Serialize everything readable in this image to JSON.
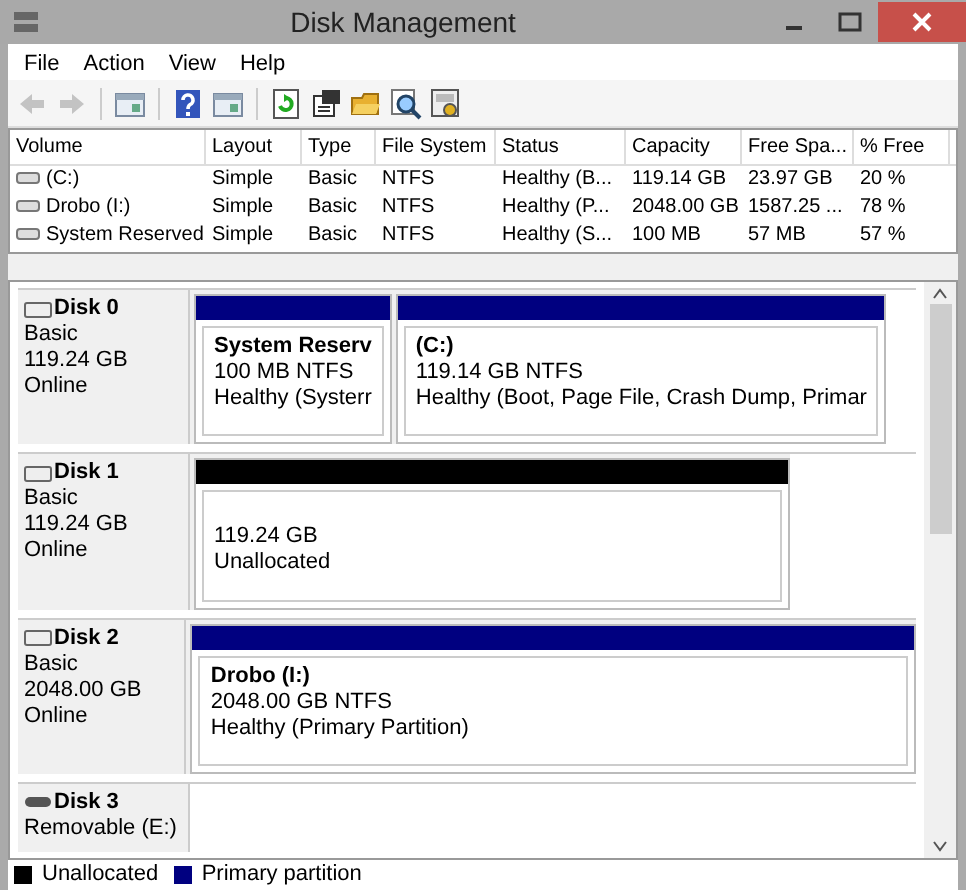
{
  "window": {
    "title": "Disk Management"
  },
  "menu": [
    "File",
    "Action",
    "View",
    "Help"
  ],
  "toolbar": [
    {
      "kind": "back",
      "disabled": true
    },
    {
      "kind": "forward",
      "disabled": true
    },
    {
      "kind": "separator"
    },
    {
      "kind": "panel"
    },
    {
      "kind": "separator"
    },
    {
      "kind": "help"
    },
    {
      "kind": "panel"
    },
    {
      "kind": "separator"
    },
    {
      "kind": "refresh"
    },
    {
      "kind": "properties"
    },
    {
      "kind": "folder"
    },
    {
      "kind": "search"
    },
    {
      "kind": "settings"
    }
  ],
  "volumes": {
    "columns": [
      "Volume",
      "Layout",
      "Type",
      "File System",
      "Status",
      "Capacity",
      "Free Spa...",
      "% Free"
    ],
    "rows": [
      [
        "(C:)",
        "Simple",
        "Basic",
        "NTFS",
        "Healthy (B...",
        "119.14 GB",
        "23.97 GB",
        "20 %"
      ],
      [
        "Drobo (I:)",
        "Simple",
        "Basic",
        "NTFS",
        "Healthy (P...",
        "2048.00 GB",
        "1587.25 ...",
        "78 %"
      ],
      [
        "System Reserved",
        "Simple",
        "Basic",
        "NTFS",
        "Healthy (S...",
        "100 MB",
        "57 MB",
        "57 %"
      ]
    ]
  },
  "disks": [
    {
      "name": "Disk 0",
      "kind": "fixed",
      "lines": [
        "Basic",
        "119.24 GB",
        "Online"
      ],
      "partitions": [
        {
          "kind": "primary",
          "title": "System Reserv",
          "lines": [
            "100 MB NTFS",
            "Healthy (Systerr"
          ]
        },
        {
          "kind": "primary",
          "title": "(C:)",
          "lines": [
            "119.14 GB NTFS",
            "Healthy (Boot, Page File, Crash Dump, Primar"
          ]
        }
      ]
    },
    {
      "name": "Disk 1",
      "kind": "fixed",
      "lines": [
        "Basic",
        "119.24 GB",
        "Online"
      ],
      "partitions": [
        {
          "kind": "unallocated",
          "lines": [
            "119.24 GB",
            "Unallocated"
          ]
        }
      ]
    },
    {
      "name": "Disk 2",
      "kind": "fixed",
      "lines": [
        "Basic",
        "2048.00 GB",
        "Online"
      ],
      "partitions": [
        {
          "kind": "primary",
          "title": "Drobo  (I:)",
          "lines": [
            "2048.00 GB NTFS",
            "Healthy (Primary Partition)"
          ]
        }
      ]
    },
    {
      "name": "Disk 3",
      "kind": "removable",
      "lines": [
        "Removable (E:)"
      ]
    }
  ],
  "legend": [
    {
      "label": "Unallocated",
      "color": "#000000"
    },
    {
      "label": "Primary partition",
      "color": "#000080"
    }
  ]
}
